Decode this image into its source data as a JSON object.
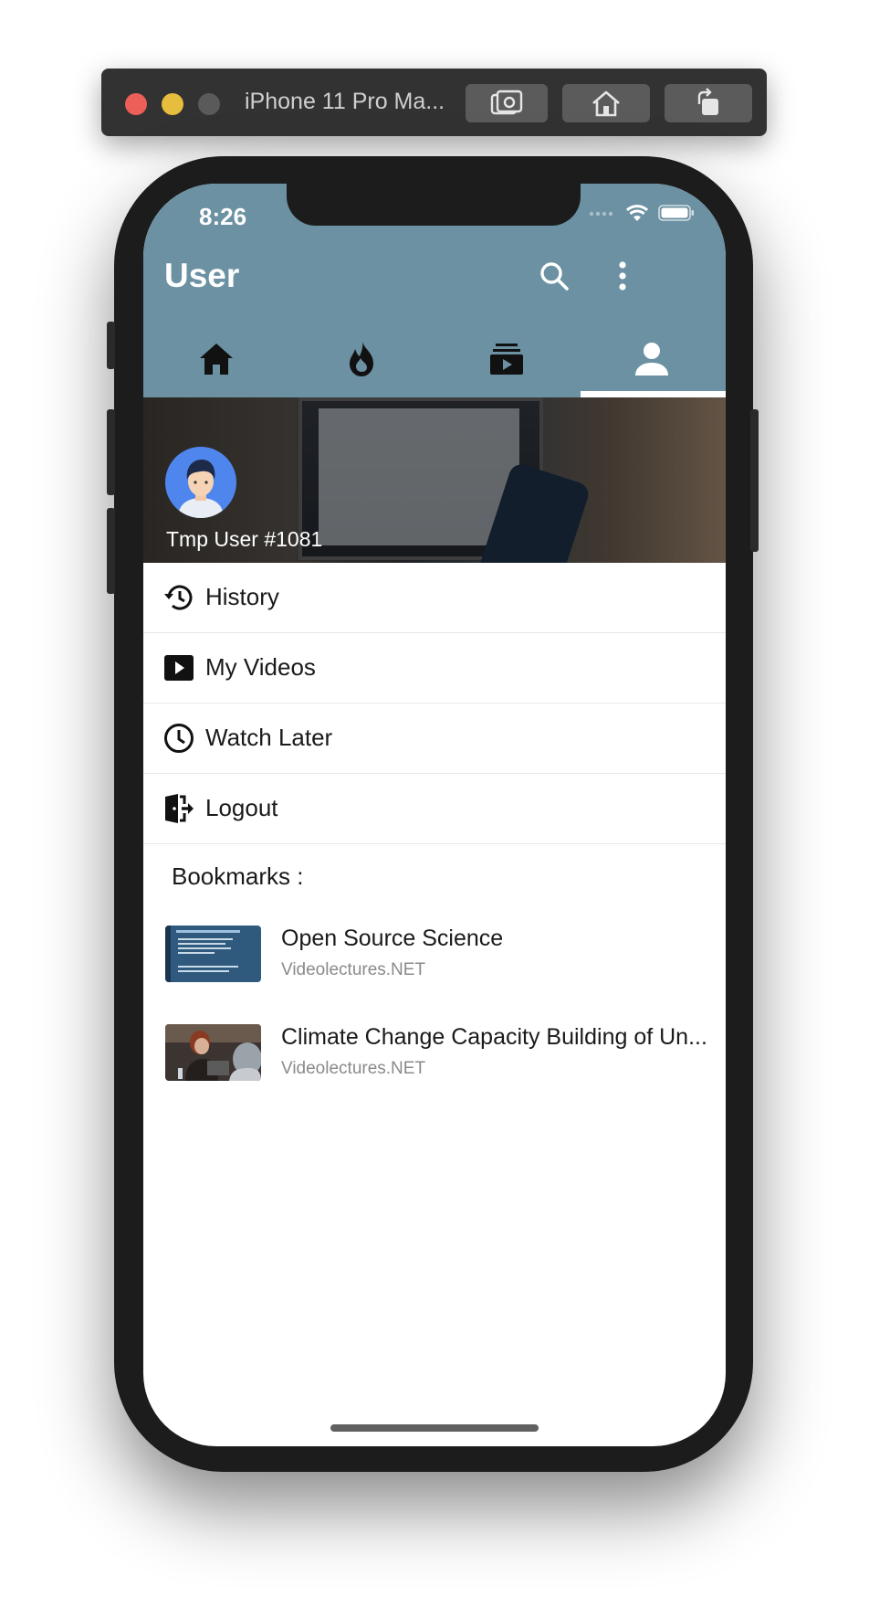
{
  "simulator": {
    "title": "iPhone 11 Pro Ma...",
    "buttons": [
      "screenshot-icon",
      "home-icon",
      "rotate-icon"
    ]
  },
  "status_bar": {
    "time": "8:26"
  },
  "app_bar": {
    "title": "User",
    "actions": [
      "search-icon",
      "more-vert-icon"
    ],
    "background": "#6b91a2"
  },
  "tabs": [
    {
      "icon": "home-icon",
      "selected": false
    },
    {
      "icon": "fire-icon",
      "selected": false
    },
    {
      "icon": "subscriptions-icon",
      "selected": false
    },
    {
      "icon": "person-icon",
      "selected": true
    }
  ],
  "profile": {
    "name": "Tmp User #1081",
    "avatar_color": "#4f86ee"
  },
  "menu": [
    {
      "icon": "history-icon",
      "label": "History"
    },
    {
      "icon": "video-icon",
      "label": "My Videos"
    },
    {
      "icon": "clock-icon",
      "label": "Watch Later"
    },
    {
      "icon": "logout-icon",
      "label": "Logout"
    }
  ],
  "bookmarks": {
    "heading": "Bookmarks :",
    "items": [
      {
        "title": "Open Source Science",
        "source": "Videolectures.NET"
      },
      {
        "title": "Climate Change  Capacity Building of Un...",
        "source": "Videolectures.NET"
      }
    ]
  }
}
